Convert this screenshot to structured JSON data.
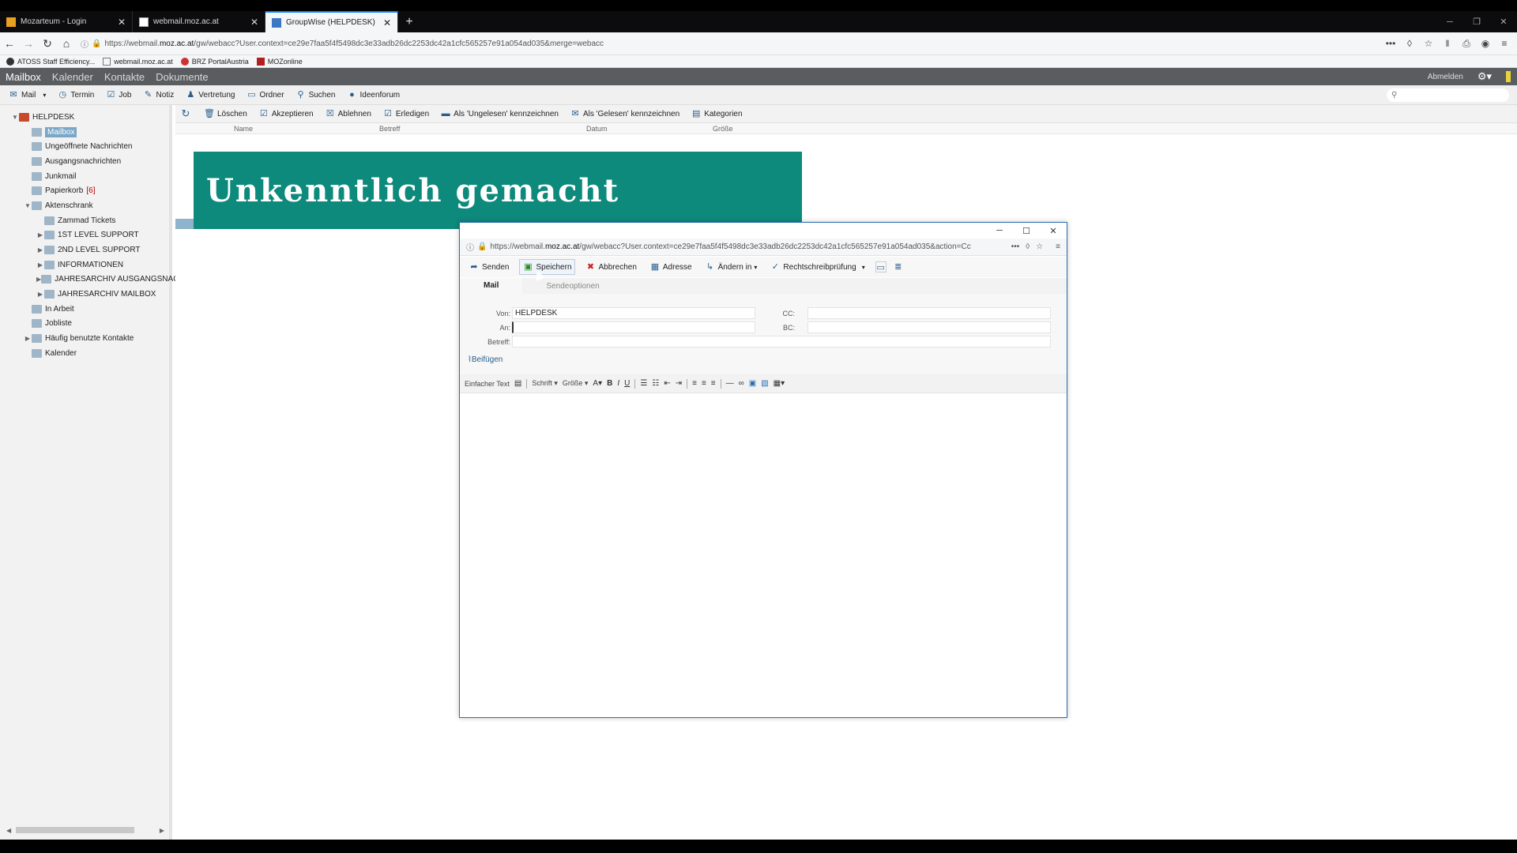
{
  "browser": {
    "tabs": [
      {
        "title": "Mozarteum - Login",
        "active": false
      },
      {
        "title": "webmail.moz.ac.at",
        "active": false
      },
      {
        "title": "GroupWise (HELPDESK)",
        "active": true
      }
    ],
    "url_prefix": "https://webmail.",
    "url_domain": "moz.ac.at",
    "url_rest": "/gw/webacc?User.context=ce29e7faa5f4f5498dc3e33adb26dc2253dc42a1cfc565257e91a054ad035&merge=webacc",
    "bookmarks": [
      "ATOSS Staff Efficiency...",
      "webmail.moz.ac.at",
      "BRZ PortalAustria",
      "MOZonline"
    ]
  },
  "app": {
    "modules": [
      "Mailbox",
      "Kalender",
      "Kontakte",
      "Dokumente"
    ],
    "logout": "Abmelden",
    "toolbar": [
      "Mail",
      "Termin",
      "Job",
      "Notiz",
      "Vertretung",
      "Ordner",
      "Suchen",
      "Ideenforum"
    ]
  },
  "sidebar": {
    "items": [
      {
        "label": "HELPDESK",
        "level": 0,
        "exp": "▼"
      },
      {
        "label": "Mailbox",
        "level": 1,
        "selected": true
      },
      {
        "label": "Ungeöffnete Nachrichten",
        "level": 1
      },
      {
        "label": "Ausgangsnachrichten",
        "level": 1
      },
      {
        "label": "Junkmail",
        "level": 1
      },
      {
        "label": "Papierkorb",
        "level": 1,
        "badge": "[6]"
      },
      {
        "label": "Aktenschrank",
        "level": 1,
        "exp": "▼"
      },
      {
        "label": "Zammad Tickets",
        "level": 2
      },
      {
        "label": "1ST LEVEL SUPPORT",
        "level": 2,
        "exp": "▶"
      },
      {
        "label": "2ND LEVEL SUPPORT",
        "level": 2,
        "exp": "▶"
      },
      {
        "label": "INFORMATIONEN",
        "level": 2,
        "exp": "▶"
      },
      {
        "label": "JAHRESARCHIV AUSGANGSNACH",
        "level": 2,
        "exp": "▶"
      },
      {
        "label": "JAHRESARCHIV MAILBOX",
        "level": 2,
        "exp": "▶"
      },
      {
        "label": "In Arbeit",
        "level": 1
      },
      {
        "label": "Jobliste",
        "level": 1
      },
      {
        "label": "Häufig benutzte Kontakte",
        "level": 1,
        "exp": "▶"
      },
      {
        "label": "Kalender",
        "level": 1
      }
    ]
  },
  "main": {
    "toolbar": [
      "Löschen",
      "Akzeptieren",
      "Ablehnen",
      "Erledigen",
      "Als 'Ungelesen' kennzeichnen",
      "Als 'Gelesen' kennzeichnen",
      "Kategorien"
    ],
    "columns": [
      "Name",
      "Betreff",
      "Datum",
      "Größe"
    ]
  },
  "redaction": "Unkenntlich gemacht",
  "popup": {
    "url_prefix": "https://webmail.",
    "url_domain": "moz.ac.at",
    "url_rest": "/gw/webacc?User.context=ce29e7faa5f4f5498dc3e33adb26dc2253dc42a1cfc565257e91a054ad035&action=Cc",
    "toolbar": [
      "Senden",
      "Speichern",
      "Abbrechen",
      "Adresse",
      "Ändern in",
      "Rechtschreibprüfung"
    ],
    "tabs": [
      "Mail",
      "Sendeoptionen"
    ],
    "form": {
      "from_label": "Von:",
      "from_value": "HELPDESK",
      "to_label": "An:",
      "to_value": "",
      "subject_label": "Betreff:",
      "subject_value": "",
      "cc_label": "CC:",
      "bc_label": "BC:"
    },
    "attach": "Beifügen",
    "editor": {
      "plain_text": "Einfacher Text",
      "font": "Schrift",
      "size": "Größe"
    }
  },
  "colors": {
    "accent": "#0a84ff",
    "header": "#5a5d60",
    "redaction": "#0d8a7c",
    "selection": "#7aa7c7"
  }
}
